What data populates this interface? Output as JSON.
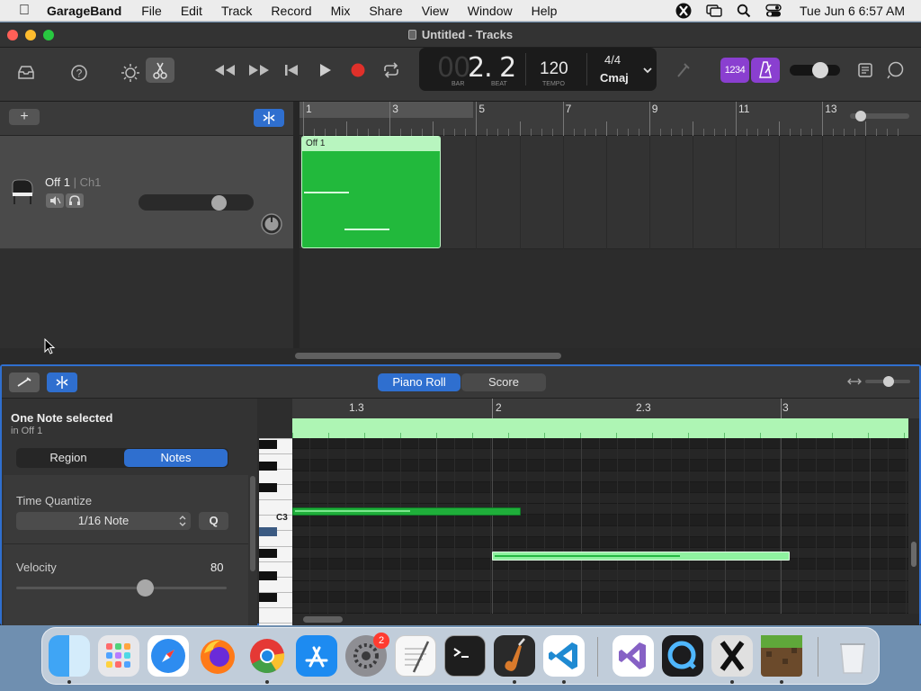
{
  "menubar": {
    "app_name": "GarageBand",
    "items": [
      "File",
      "Edit",
      "Track",
      "Record",
      "Mix",
      "Share",
      "View",
      "Window",
      "Help"
    ],
    "clock": "Tue Jun 6  6:57 AM"
  },
  "window": {
    "title": "Untitled - Tracks"
  },
  "lcd": {
    "bar_value": "00",
    "beat_value": "2. 2",
    "bar_label": "BAR",
    "beat_label": "BEAT",
    "tempo_value": "120",
    "tempo_label": "TEMPO",
    "time_signature": "4/4",
    "key": "Cmaj"
  },
  "toolbar": {
    "count_in_label": "1234"
  },
  "ruler": {
    "bars": [
      "1",
      "3",
      "5",
      "7",
      "9",
      "11",
      "13"
    ]
  },
  "track": {
    "name": "Off 1",
    "channel": "| Ch1"
  },
  "region": {
    "name": "Off 1",
    "color": "#22b93c"
  },
  "editor": {
    "tabs": [
      "Piano Roll",
      "Score"
    ],
    "active_tab": "Piano Roll",
    "selection_status": "One Note selected",
    "selection_context": "in Off 1",
    "inspector_tabs": [
      "Region",
      "Notes"
    ],
    "active_inspector_tab": "Notes",
    "time_quantize_label": "Time Quantize",
    "time_quantize_value": "1/16 Note",
    "quantize_button": "Q",
    "velocity_label": "Velocity",
    "velocity_value": "80",
    "ruler_marks": [
      "1.3",
      "2",
      "2.3",
      "3"
    ],
    "key_label": "C3"
  },
  "dock": {
    "badge_count": "2"
  }
}
